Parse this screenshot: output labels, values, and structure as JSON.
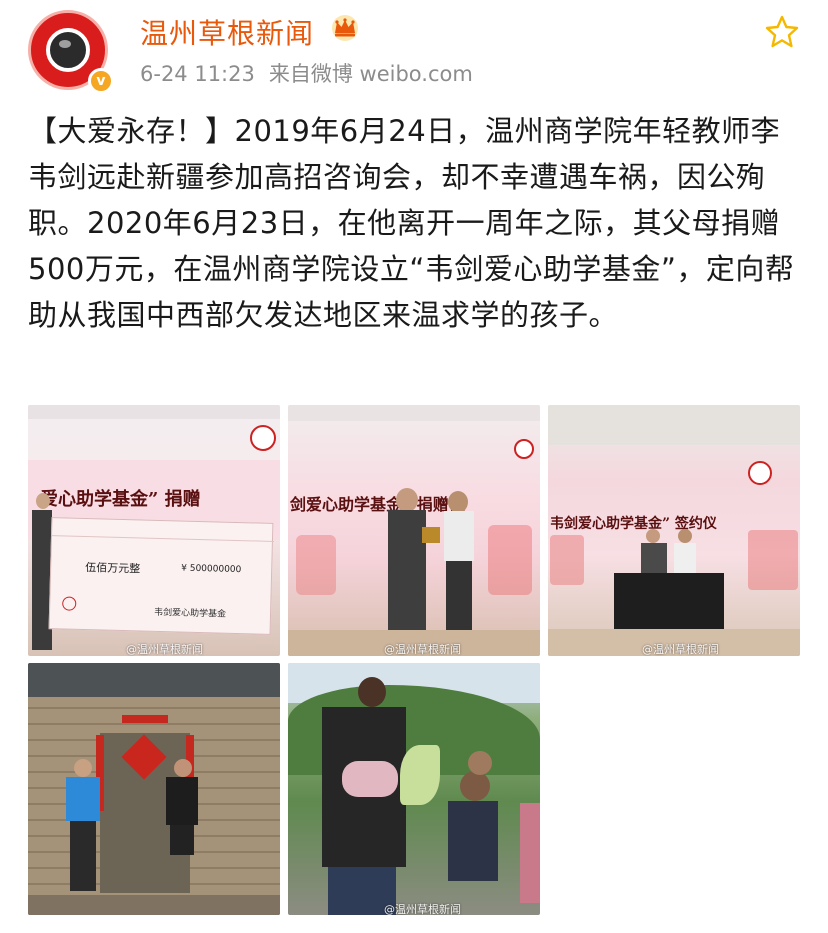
{
  "header": {
    "username": "温州草根新闻",
    "time": "6-24 11:23",
    "source": "来自微博 weibo.com"
  },
  "post": {
    "text": "【大爱永存！】2019年6月24日，温州商学院年轻教师李韦剑远赴新疆参加高招咨询会，却不幸遭遇车祸，因公殉职。2020年6月23日，在他离开一周年之际，其父母捐赠500万元，在温州商学院设立“韦剑爱心助学基金”，定向帮助从我国中西部欠发达地区来温求学的孩子。"
  },
  "photos": [
    {
      "banner": "爱心助学基金” 捐赠",
      "check_amount": "伍佰万元整",
      "check_number": "¥ 500000000",
      "check_org": "韦剑爱心助学基金",
      "watermark": "@温州草根新闻"
    },
    {
      "banner": "剑爱心助学基金” 捐赠仪",
      "watermark": "@温州草根新闻"
    },
    {
      "banner": "韦剑爱心助学基金” 签约仪",
      "watermark": "@温州草根新闻"
    },
    {
      "watermark": ""
    },
    {
      "watermark": "@温州草根新闻"
    }
  ],
  "colors": {
    "username": "#e8590c",
    "meta": "#8c8c8c",
    "star": "#f5b800",
    "avatar": "#d91c1c"
  },
  "icons": {
    "avatar": "camera-lens-avatar",
    "verified": "verified-badge-icon",
    "crown": "crown-icon",
    "favorite": "star-icon"
  }
}
